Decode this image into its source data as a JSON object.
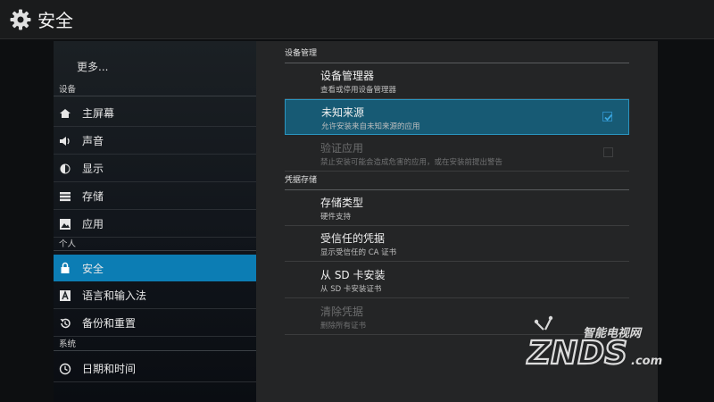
{
  "actionbar": {
    "title": "安全",
    "icon": "gear-icon"
  },
  "sidebar": {
    "more": "更多...",
    "headers": {
      "device": "设备",
      "personal": "个人",
      "system": "系统"
    },
    "items": [
      {
        "label": "主屏幕",
        "icon": "home-icon"
      },
      {
        "label": "声音",
        "icon": "speaker-icon"
      },
      {
        "label": "显示",
        "icon": "brightness-icon"
      },
      {
        "label": "存储",
        "icon": "storage-icon"
      },
      {
        "label": "应用",
        "icon": "apps-icon"
      },
      {
        "label": "安全",
        "icon": "lock-icon",
        "active": true
      },
      {
        "label": "语言和输入法",
        "icon": "language-icon"
      },
      {
        "label": "备份和重置",
        "icon": "backup-icon"
      },
      {
        "label": "日期和时间",
        "icon": "clock-icon"
      }
    ]
  },
  "panel": {
    "cat_device_admin": "设备管理",
    "device_admins": {
      "title": "设备管理器",
      "summary": "查看或停用设备管理器"
    },
    "unknown_sources": {
      "title": "未知来源",
      "summary": "允许安装来自未知来源的应用",
      "checked": true
    },
    "verify_apps": {
      "title": "验证应用",
      "summary": "禁止安装可能会造成危害的应用，或在安装前提出警告",
      "checked": false,
      "enabled": false
    },
    "cat_credentials": "凭据存储",
    "storage_type": {
      "title": "存储类型",
      "summary": "硬件支持"
    },
    "trusted_credentials": {
      "title": "受信任的凭据",
      "summary": "显示受信任的 CA 证书"
    },
    "install_from_sd": {
      "title": "从 SD 卡安装",
      "summary": "从 SD 卡安装证书"
    },
    "clear_credentials": {
      "title": "清除凭据",
      "summary": "删除所有证书",
      "enabled": false
    }
  },
  "watermark": {
    "top_text": "智能电视网",
    "main_text": "ZNDS",
    "suffix": ".com"
  },
  "colors": {
    "accent": "#0c7db4",
    "selected_bg": "#175a74",
    "check": "#2c8bc0"
  }
}
